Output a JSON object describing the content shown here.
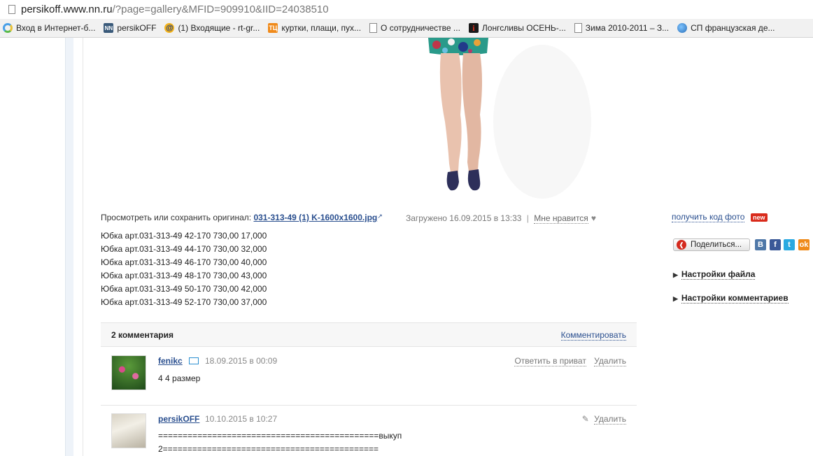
{
  "browser": {
    "url_host": "persikoff.www.nn.ru",
    "url_path": "/?page=gallery&MFID=909910&IID=24038510",
    "bookmarks": [
      {
        "icon": "ring-icon",
        "label": "Вход в Интернет-б..."
      },
      {
        "icon": "nn-icon",
        "label": "persikOFF"
      },
      {
        "icon": "at-icon",
        "label": "(1) Входящие - rt-gr..."
      },
      {
        "icon": "tc-icon",
        "label": "куртки, плащи, пух..."
      },
      {
        "icon": "doc-icon",
        "label": "О сотрудничестве ..."
      },
      {
        "icon": "i-icon",
        "label": "Лонгсливы ОСЕНЬ-..."
      },
      {
        "icon": "doc-icon",
        "label": "Зима 2010-2011 – З..."
      },
      {
        "icon": "globe-icon",
        "label": "СП французская де..."
      }
    ]
  },
  "photo": {
    "caption_prefix": "Просмотреть или сохранить оригинал:",
    "filename": "031-313-49 (1) K-1600x1600.jpg",
    "uploaded": "Загружено 16.09.2015 в 13:33",
    "separator": "|",
    "like": "Мне нравится",
    "description": [
      "Юбка арт.031-313-49 42-170 730,00 17,000",
      "Юбка арт.031-313-49 44-170 730,00 32,000",
      "Юбка арт.031-313-49 46-170 730,00 40,000",
      "Юбка арт.031-313-49 48-170 730,00 43,000",
      "Юбка арт.031-313-49 50-170 730,00 42,000",
      "Юбка арт.031-313-49 52-170 730,00 37,000"
    ]
  },
  "sidebar": {
    "get_code": "получить код фото",
    "new_badge": "new",
    "share": "Поделиться...",
    "file_settings": "Настройки файла",
    "comment_settings": "Настройки комментариев"
  },
  "comments": {
    "count_label": "2 комментария",
    "write_label": "Комментировать",
    "items": [
      {
        "author": "fenikc",
        "date": "18.09.2015 в 00:09",
        "reply": "Ответить в приват",
        "delete": "Удалить",
        "text": "4 4 размер"
      },
      {
        "author": "persikOFF",
        "date": "10.10.2015 в 10:27",
        "delete": "Удалить",
        "text_line1": "=============================================выкуп",
        "text_line2": "2============================================"
      }
    ]
  },
  "colors": {
    "link": "#2a4f8f",
    "badge_new": "#d92b1c"
  }
}
